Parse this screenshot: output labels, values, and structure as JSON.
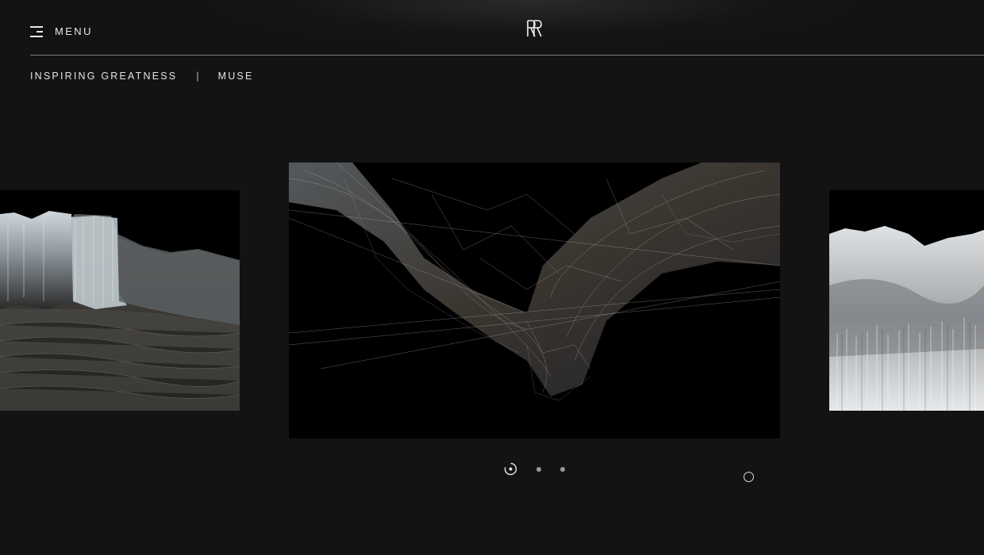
{
  "header": {
    "menu_label": "MENU",
    "menu_icon": "hamburger-menu-icon",
    "logo_icon": "rr-monogram-logo"
  },
  "breadcrumb": {
    "items": [
      {
        "label": "INSPIRING GREATNESS"
      },
      {
        "label": "MUSE"
      }
    ],
    "separator": "|"
  },
  "carousel": {
    "slides": [
      {
        "position": "previous",
        "description_icon": "ice-landscape-image"
      },
      {
        "position": "current",
        "description_icon": "wireframe-landscape-image"
      },
      {
        "position": "next",
        "description_icon": "crystal-landscape-image"
      }
    ],
    "pagination": {
      "count": 3,
      "active_index": 0
    }
  },
  "colors": {
    "background": "#131313",
    "text": "#e8e8e8",
    "rule": "#7a7a7a",
    "inactive_dot": "#9a9a9a"
  }
}
